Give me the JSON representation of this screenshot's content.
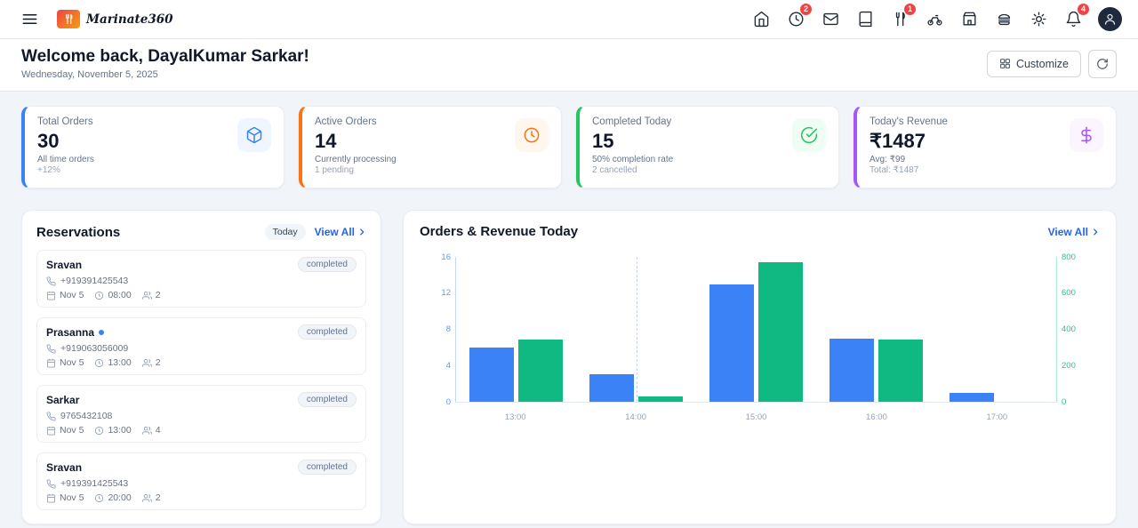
{
  "navbar": {
    "logo_text": "Marinate360",
    "icons": [
      "hamburger-menu",
      "home",
      "clock",
      "mail",
      "menu-book",
      "dining",
      "delivery-bike",
      "store",
      "food",
      "settings",
      "notifications",
      "avatar"
    ],
    "badges": {
      "clock": "2",
      "dining": "1",
      "bell": "4"
    }
  },
  "welcome": {
    "title": "Welcome back, DayalKumar Sarkar!",
    "date": "Wednesday, November 5, 2025",
    "customize_label": "Customize"
  },
  "stats": [
    {
      "label": "Total Orders",
      "value": "30",
      "sub1": "All time orders",
      "sub2": "+12%",
      "accent": "#3b82f6",
      "icon": "package-icon"
    },
    {
      "label": "Active Orders",
      "value": "14",
      "sub1": "Currently processing",
      "sub2": "1 pending",
      "accent": "#f97316",
      "icon": "clock-icon"
    },
    {
      "label": "Completed Today",
      "value": "15",
      "sub1": "50% completion rate",
      "sub2": "2 cancelled",
      "accent": "#22c55e",
      "icon": "check-circle-icon"
    },
    {
      "label": "Today's Revenue",
      "value": "₹1487",
      "sub1": "Avg: ₹99",
      "sub2": "Total: ₹1487",
      "accent": "#a855f7",
      "icon": "dollar-icon"
    }
  ],
  "reservations": {
    "title": "Reservations",
    "filter_label": "Today",
    "view_all": "View All",
    "items": [
      {
        "name": "Sravan",
        "dot": false,
        "status": "completed",
        "phone": "+919391425543",
        "date": "Nov 5",
        "time": "08:00",
        "guests": "2"
      },
      {
        "name": "Prasanna",
        "dot": true,
        "status": "completed",
        "phone": "+919063056009",
        "date": "Nov 5",
        "time": "13:00",
        "guests": "2"
      },
      {
        "name": "Sarkar",
        "dot": false,
        "status": "completed",
        "phone": "9765432108",
        "date": "Nov 5",
        "time": "13:00",
        "guests": "4"
      },
      {
        "name": "Sravan",
        "dot": false,
        "status": "completed",
        "phone": "+919391425543",
        "date": "Nov 5",
        "time": "20:00",
        "guests": "2"
      }
    ]
  },
  "chart": {
    "title": "Orders & Revenue Today",
    "view_all": "View All"
  },
  "chart_data": {
    "type": "bar",
    "title": "Orders & Revenue Today",
    "categories": [
      "13:00",
      "14:00",
      "15:00",
      "16:00",
      "17:00"
    ],
    "series": [
      {
        "name": "Orders",
        "axis": "left",
        "color": "#3b82f6",
        "values": [
          6,
          3,
          13,
          7,
          1
        ]
      },
      {
        "name": "Revenue",
        "axis": "right",
        "color": "#10b981",
        "values": [
          345,
          30,
          770,
          342,
          0
        ]
      }
    ],
    "left_axis": {
      "ticks": [
        0,
        4,
        8,
        12,
        16
      ],
      "max": 16
    },
    "right_axis": {
      "ticks": [
        0,
        200,
        400,
        600,
        800
      ],
      "max": 800
    },
    "crosshair_at": "14:00",
    "legend": "none",
    "grid": "off"
  }
}
